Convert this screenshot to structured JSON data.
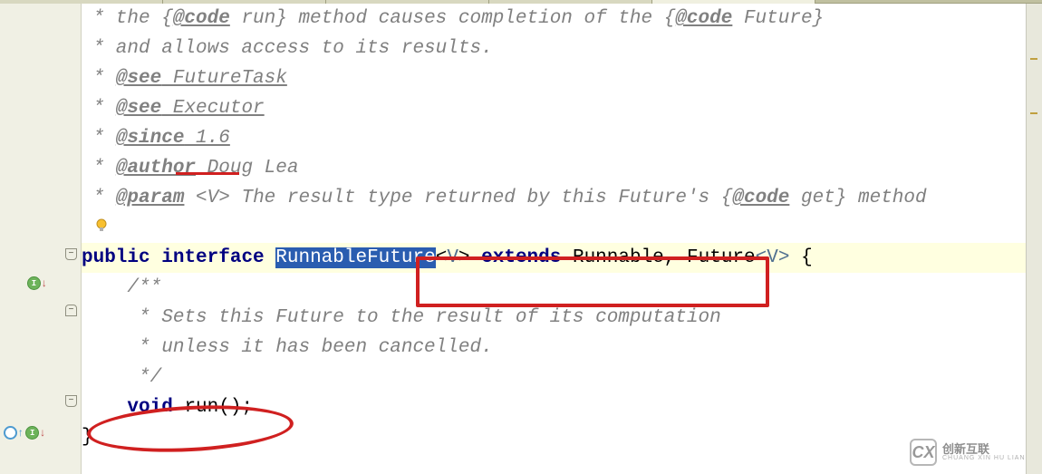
{
  "tabs": [
    {
      "label": ""
    },
    {
      "label": ""
    },
    {
      "label": ""
    },
    {
      "label": ""
    },
    {
      "label": ""
    }
  ],
  "javadoc": {
    "line1_prefix": " * the {",
    "line1_tag": "@code",
    "line1_mid": " run} method causes completion of the {",
    "line1_tag2": "@code",
    "line1_suffix": " Future}",
    "line2": " * and allows access to its results.",
    "see1_star": " * ",
    "see1_tag": "@see",
    "see1_val": " FutureTask",
    "see2_star": " * ",
    "see2_tag": "@see",
    "see2_val": " Executor",
    "since_star": " * ",
    "since_tag": "@since",
    "since_val": " 1.6",
    "author_star": " * ",
    "author_tag": "@author",
    "author_val": " Doug Lea",
    "param_star": " * ",
    "param_tag": "@param",
    "param_var": " <V>",
    "param_mid": " The result type returned by this Future's {",
    "param_tag2": "@code",
    "param_suffix": " get} method",
    "end": " */"
  },
  "decl": {
    "public": "public",
    "interface": "interface",
    "name": "RunnableFuture",
    "tp_open": "<",
    "tp": "V",
    "tp_close": ">",
    "extends": "extends",
    "runnable": "Runnable",
    "comma": ", ",
    "future": "Future",
    "tp2_open": "<",
    "tp2": "V",
    "tp2_close": ">",
    "brace": " {"
  },
  "method_doc": {
    "open": "    /**",
    "l1": "     * Sets this Future to the result of its computation",
    "l2": "     * unless it has been cancelled.",
    "close": "     */"
  },
  "method": {
    "indent": "    ",
    "kw": "void",
    "name": " run",
    "sig": "();"
  },
  "close_brace": "}",
  "watermark": {
    "logo": "CX",
    "main": "创新互联",
    "sub": "CHUANG XIN HU LIAN"
  }
}
